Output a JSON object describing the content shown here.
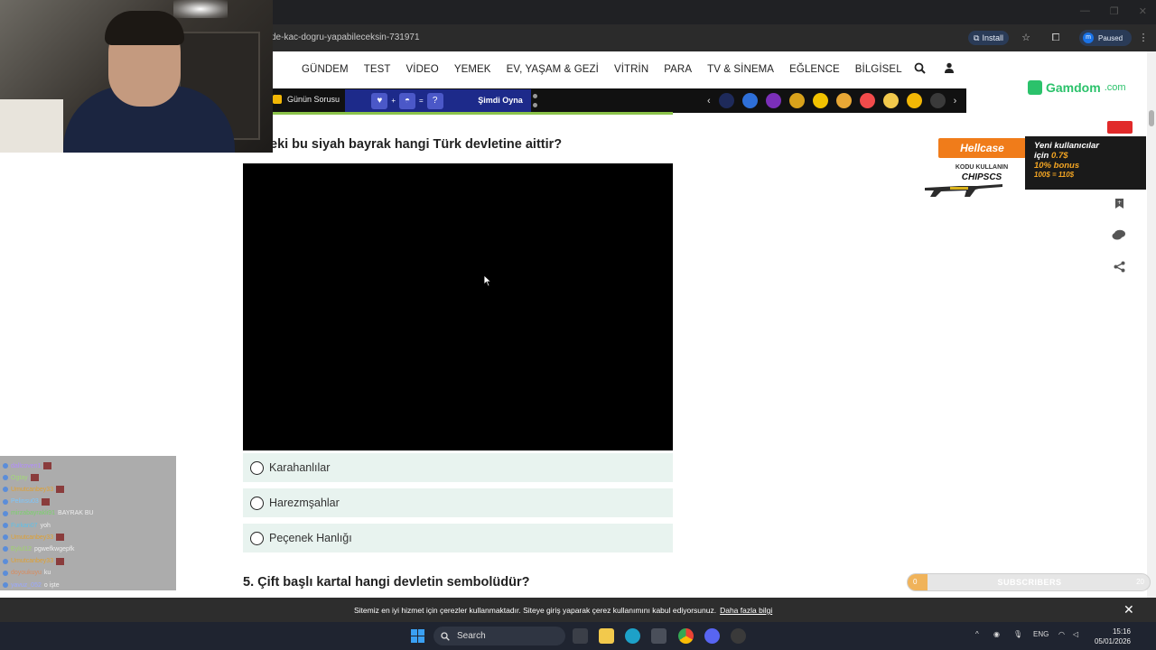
{
  "browser": {
    "url": "de-kac-dogru-yapabileceksin-731971",
    "install_label": "Install",
    "profile_initial": "m",
    "profile_status": "Paused"
  },
  "nav": {
    "items": [
      "GÜNDEM",
      "TEST",
      "VİDEO",
      "YEMEK",
      "EV, YAŞAM & GEZİ",
      "VİTRİN",
      "PARA",
      "TV & SİNEMA",
      "EĞLENCE",
      "BİLGİSEL"
    ]
  },
  "subbar": {
    "gunun_sorusu": "Günün Sorusu",
    "quiz_plus": "+",
    "quiz_eq": "=",
    "quiz_q": "?",
    "play_now": "Şimdi Oyna",
    "emoji_colors": [
      "#1e2a5a",
      "#2e6fd8",
      "#7b2fb8",
      "#d9a21b",
      "#f2c200",
      "#e8a735",
      "#f24b4b",
      "#f2c94c",
      "#f2b705",
      "#3a3a3a"
    ]
  },
  "quiz": {
    "question_4": "eki bu siyah bayrak hangi Türk devletine aittir?",
    "options": [
      "Karahanlılar",
      "Harezmşahlar",
      "Peçenek Hanlığı"
    ],
    "question_5": "5. Çift başlı kartal hangi devletin sembolüdür?"
  },
  "ads": {
    "gamdom": "Gamdom",
    "gamdom_tld": ".com",
    "hellcase": "Hellcase",
    "code_label": "KODU KULLANIN",
    "code": "CHIPSCS",
    "promo_line1": "Yeni kullanıcılar",
    "promo_line2_prefix": "için",
    "promo_line2_value": "0.7$",
    "promo_line3": "10% bonus",
    "promo_line4": "100$ = 110$"
  },
  "chat": [
    {
      "user": "dallcoven1",
      "msg": "",
      "color": "#b38cff"
    },
    {
      "user": "Ogtay",
      "msg": "",
      "color": "#a3d977"
    },
    {
      "user": "Umutcanbey33",
      "msg": "",
      "color": "#e0a030"
    },
    {
      "user": "Pelinsu03",
      "msg": "",
      "color": "#7ac7ff"
    },
    {
      "user": "mirzabayrakli91",
      "msg": "BAYRAK BU",
      "color": "#7ad16b"
    },
    {
      "user": "Furkan07",
      "msg": "yoh",
      "color": "#5ec0e8"
    },
    {
      "user": "Umutcanbey33",
      "msg": "",
      "color": "#e0a030"
    },
    {
      "user": "Eylul12",
      "msg": "pgwefkwgepfk",
      "color": "#9fd46b"
    },
    {
      "user": "Umutcanbey33",
      "msg": "",
      "color": "#e0a030"
    },
    {
      "user": "doyoukuyu",
      "msg": "ku",
      "color": "#d98c5e"
    },
    {
      "user": "yavuz_052",
      "msg": "o işte",
      "color": "#9aa8ff"
    }
  ],
  "subscribers": {
    "label": "SUBSCRIBERS",
    "current": "0",
    "goal": "20",
    "progress_fraction": 0.0
  },
  "cookie": {
    "message": "Sitemiz en iyi hizmet için çerezler kullanmaktadır. Siteye giriş yaparak çerez kullanımını kabul ediyorsunuz.",
    "more_link": "Daha fazla bilgi"
  },
  "taskbar": {
    "search_label": "Search",
    "language": "ENG",
    "time": "15:16",
    "date": "05/01/2026"
  }
}
